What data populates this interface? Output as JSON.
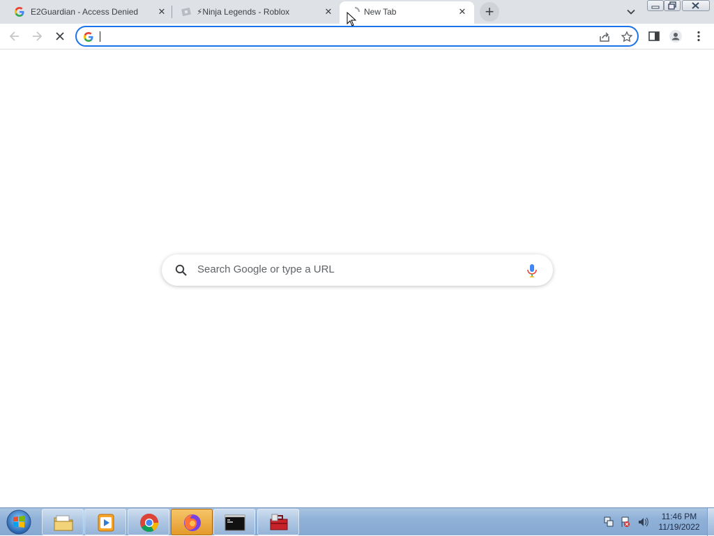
{
  "browser": {
    "tabs": [
      {
        "title": "E2Guardian - Access Denied",
        "favicon": "google-g-icon"
      },
      {
        "title": "⚡Ninja Legends - Roblox",
        "favicon": "roblox-icon"
      },
      {
        "title": "New Tab",
        "favicon": "loading-icon"
      }
    ],
    "new_tab_symbol": "+",
    "tab_close_symbol": "✕"
  },
  "toolbar": {
    "address_value": "",
    "icons": [
      "back-arrow-icon",
      "forward-arrow-icon",
      "stop-loading-icon",
      "share-icon",
      "bookmark-star-icon",
      "side-panel-icon",
      "profile-icon",
      "kebab-menu-icon"
    ]
  },
  "newtab": {
    "search_placeholder": "Search Google or type a URL"
  },
  "taskbar": {
    "apps": [
      "file-explorer-icon",
      "media-player-icon",
      "chrome-icon",
      "firefox-icon",
      "command-prompt-icon",
      "toolbox-icon"
    ],
    "clock_time": "11:46 PM",
    "clock_date": "11/19/2022"
  },
  "colors": {
    "tabstrip": "#dee1e6",
    "focus_ring": "#1a73e8",
    "taskbar": "#8fb1d8"
  }
}
